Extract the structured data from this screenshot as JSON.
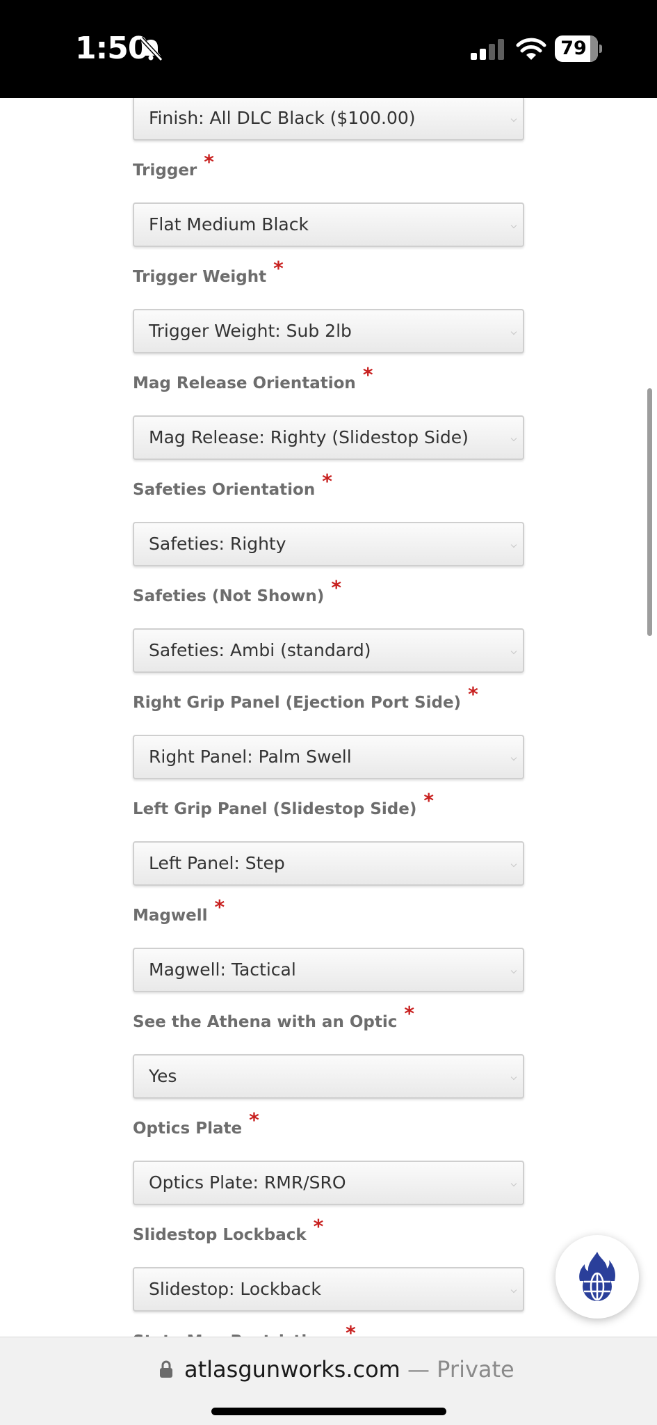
{
  "status_bar": {
    "time": "1:50",
    "battery_level": "79",
    "icons": [
      "bell-slash-icon",
      "signal-icon",
      "wifi-icon",
      "battery-icon"
    ]
  },
  "form": {
    "fields": [
      {
        "label": "",
        "value": "Finish: All DLC Black ($100.00)",
        "required": false
      },
      {
        "label": "Trigger",
        "value": "Flat Medium Black",
        "required": true
      },
      {
        "label": "Trigger Weight",
        "value": "Trigger Weight: Sub 2lb",
        "required": true
      },
      {
        "label": "Mag Release Orientation",
        "value": "Mag Release: Righty (Slidestop Side)",
        "required": true
      },
      {
        "label": "Safeties Orientation",
        "value": "Safeties: Righty",
        "required": true
      },
      {
        "label": "Safeties (Not Shown)",
        "value": "Safeties: Ambi (standard)",
        "required": true
      },
      {
        "label": "Right Grip Panel (Ejection Port Side)",
        "value": "Right Panel: Palm Swell",
        "required": true
      },
      {
        "label": "Left Grip Panel (Slidestop Side)",
        "value": "Left Panel: Step",
        "required": true
      },
      {
        "label": "Magwell",
        "value": "Magwell: Tactical",
        "required": true
      },
      {
        "label": "See the Athena with an Optic",
        "value": "Yes",
        "required": true
      },
      {
        "label": "Optics Plate",
        "value": "Optics Plate: RMR/SRO",
        "required": true
      },
      {
        "label": "Slidestop Lockback",
        "value": "Slidestop: Lockback",
        "required": true
      }
    ],
    "partial_label": "State Mag Restrictions",
    "required_marker": "*"
  },
  "floating_button": {
    "icon": "fire-globe-icon"
  },
  "browser_bar": {
    "domain": "atlasgunworks.com",
    "separator": " — ",
    "mode": "Private"
  },
  "colors": {
    "required_star": "#c8201f",
    "label": "#6d6d6d",
    "fab_icon": "#2a3f9a"
  }
}
